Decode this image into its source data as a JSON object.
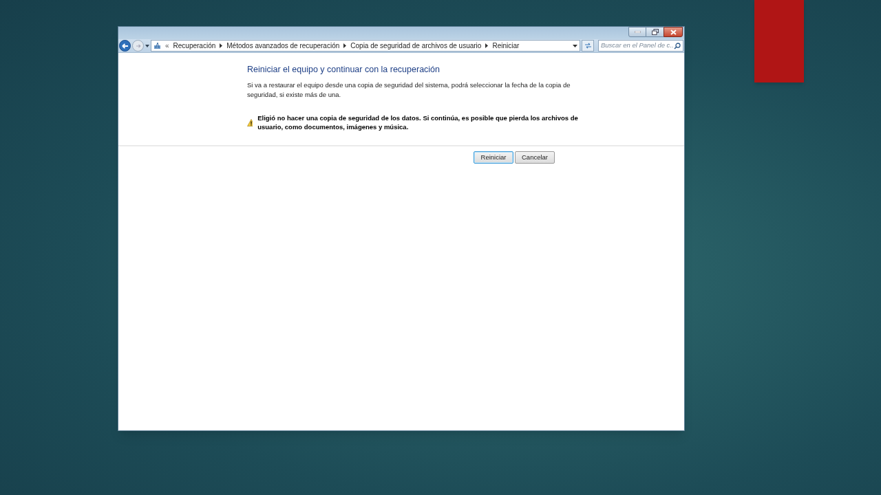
{
  "address_bar": {
    "overflow": "«",
    "breadcrumbs": [
      "Recuperación",
      "Métodos avanzados de recuperación",
      "Copia de seguridad de archivos de usuario",
      "Reiniciar"
    ]
  },
  "search": {
    "placeholder": "Buscar en el Panel de c..."
  },
  "content": {
    "title": "Reiniciar el equipo y continuar con la recuperación",
    "description": "Si va a restaurar el equipo desde una copia de seguridad del sistema, podrá seleccionar la fecha de la copia de seguridad, si existe más de una.",
    "warning": "Eligió no hacer una copia de seguridad de los datos. Si continúa, es posible que pierda los archivos de usuario, como documentos, imágenes y música."
  },
  "buttons": [
    {
      "label": "Reiniciar",
      "default": true
    },
    {
      "label": "Cancelar",
      "default": false
    }
  ]
}
